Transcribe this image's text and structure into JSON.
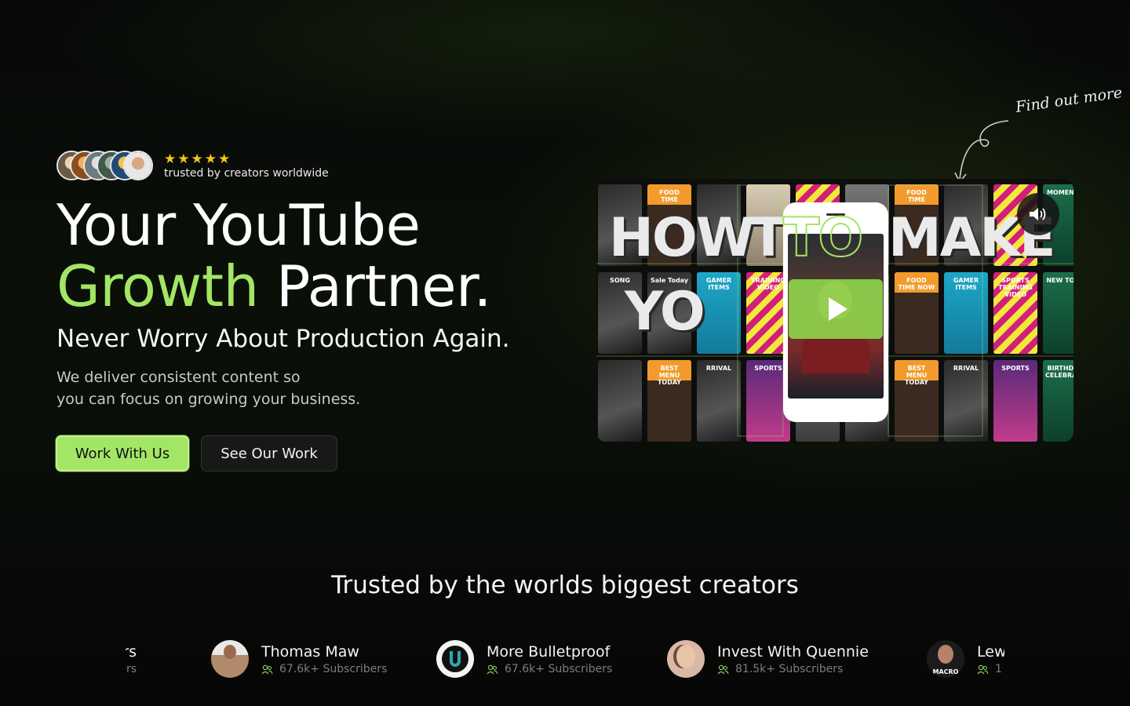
{
  "hero": {
    "rating_stars": 5,
    "trust_caption": "trusted by creators worldwide",
    "title_line1": "Your YouTube",
    "title_accent": "Growth",
    "title_rest": " Partner.",
    "subtitle": "Never Worry About Production Again.",
    "body_line1": "We deliver consistent content so",
    "body_line2": "you can focus on growing your business.",
    "cta_primary": "Work With Us",
    "cta_secondary": "See Our Work"
  },
  "video": {
    "annotation": "Find out more",
    "overlay_line1": "HOW TO MAKE",
    "overlay_line2": "YO",
    "tiles": [
      "",
      "FOOD TIME",
      "",
      "",
      "",
      "",
      "FOOD TIME",
      "",
      "",
      "MOMENTS",
      "SONG",
      "Sale Today",
      "GAMER ITEMS",
      "TRAINING VIDEO",
      "",
      "",
      "FOOD TIME NOW",
      "GAMER ITEMS",
      "SPORTS TRAINING VIDEO",
      "NEW TOYS",
      "",
      "BEST MENU TODAY",
      "RRIVAL",
      "SPORTS",
      "",
      "",
      "BEST MENU TODAY",
      "RRIVAL",
      "SPORTS",
      "BIRTHDAY CELEBRATION"
    ]
  },
  "trusted": {
    "title": "Trusted by the worlds biggest creators",
    "creators": [
      {
        "name": "hers",
        "subs": "ers"
      },
      {
        "name": "Thomas Maw",
        "subs": "67.6k+ Subscribers"
      },
      {
        "name": "More Bulletproof",
        "subs": "67.6k+ Subscribers"
      },
      {
        "name": "Invest With Quennie",
        "subs": "81.5k+ Subscribers"
      },
      {
        "name": "Lew",
        "subs": "1"
      }
    ],
    "macro_label": "MACRO"
  },
  "colors": {
    "accent": "#a3e665",
    "star": "#f5c518",
    "background": "#050505"
  }
}
